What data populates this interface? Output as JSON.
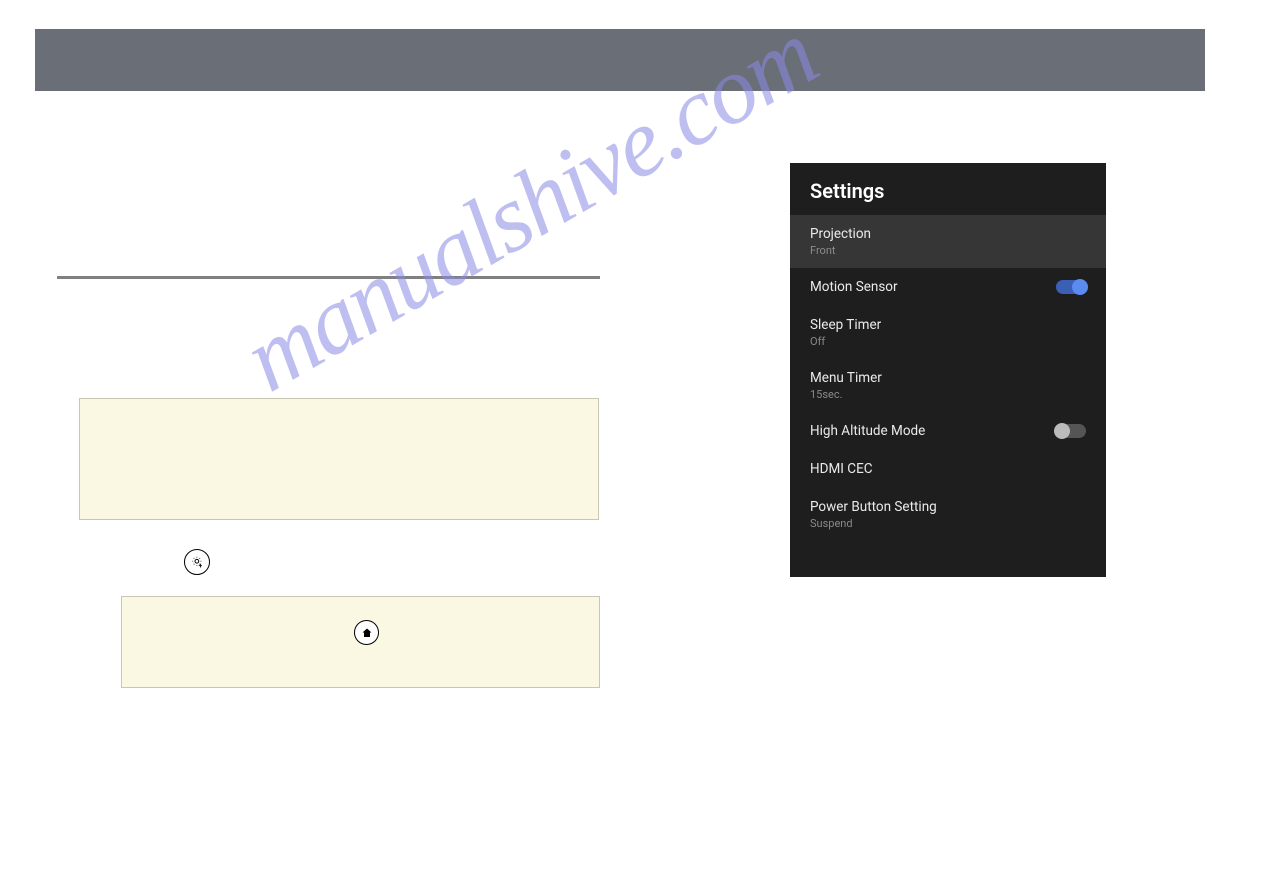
{
  "watermark": "manualshive.com",
  "settings": {
    "title": "Settings",
    "items": [
      {
        "label": "Projection",
        "sub": "Front",
        "toggle": null,
        "selected": true
      },
      {
        "label": "Motion Sensor",
        "sub": null,
        "toggle": "on",
        "selected": false
      },
      {
        "label": "Sleep Timer",
        "sub": "Off",
        "toggle": null,
        "selected": false
      },
      {
        "label": "Menu Timer",
        "sub": "15sec.",
        "toggle": null,
        "selected": false
      },
      {
        "label": "High Altitude Mode",
        "sub": null,
        "toggle": "off",
        "selected": false
      },
      {
        "label": "HDMI CEC",
        "sub": null,
        "toggle": null,
        "selected": false
      },
      {
        "label": "Power Button Setting",
        "sub": "Suspend",
        "toggle": null,
        "selected": false
      }
    ]
  }
}
